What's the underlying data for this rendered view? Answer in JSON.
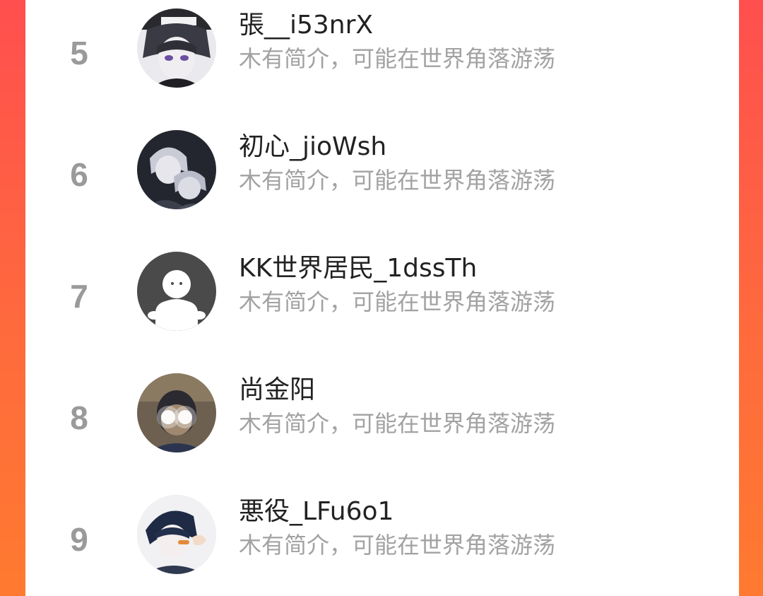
{
  "colors": {
    "background_gradient_start": "#ff4f4f",
    "background_gradient_end": "#ff7a30",
    "panel": "#ffffff",
    "rank_text": "#9a9a9a",
    "name_text": "#222222",
    "bio_text": "#a2a2a2"
  },
  "ranking": {
    "items": [
      {
        "rank": "5",
        "name": "張__i53nrX",
        "bio": "木有简介，可能在世界角落游荡",
        "avatar_icon": "anime-boy-cap-avatar"
      },
      {
        "rank": "6",
        "name": "初心_jioWsh",
        "bio": "木有简介，可能在世界角落游荡",
        "avatar_icon": "anime-duo-avatar"
      },
      {
        "rank": "7",
        "name": "KK世界居民_1dssTh",
        "bio": "木有简介，可能在世界角落游荡",
        "avatar_icon": "default-ghost-avatar"
      },
      {
        "rank": "8",
        "name": "尚金阳",
        "bio": "木有简介，可能在世界角落游荡",
        "avatar_icon": "photo-boy-glowing-eyes-avatar"
      },
      {
        "rank": "9",
        "name": "悪役_LFu6o1",
        "bio": "木有简介，可能在世界角落游荡",
        "avatar_icon": "anime-boy-blue-avatar"
      }
    ]
  }
}
